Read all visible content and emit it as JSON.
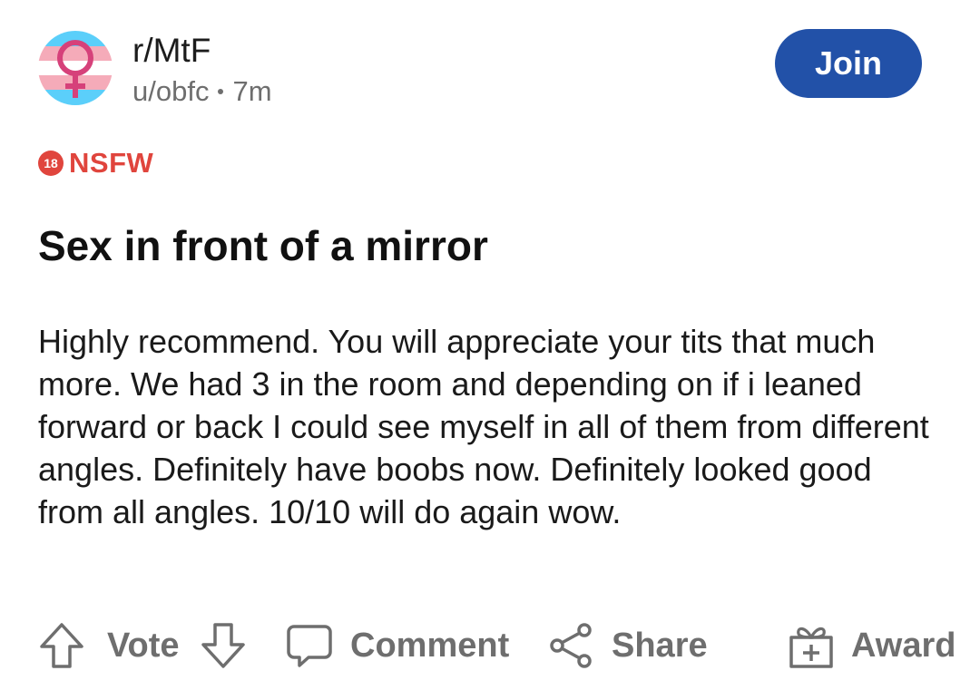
{
  "post": {
    "community": "r/MtF",
    "author": "u/obfc",
    "age": "7m",
    "join_label": "Join",
    "nsfw_badge": "18",
    "nsfw_label": "NSFW",
    "title": "Sex in front of a mirror",
    "body": "Highly recommend. You will appreciate your tits that much more. We had 3 in the room and depending on if i leaned forward or back I could see myself in all of them from different angles. Definitely have boobs now. Definitely looked good from all angles. 10/10 will do again wow."
  },
  "actions": {
    "vote_label": "Vote",
    "comment_label": "Comment",
    "share_label": "Share",
    "award_label": "Award"
  },
  "icons": {
    "avatar": "trans-flag-venus-icon",
    "upvote": "arrow-up-icon",
    "downvote": "arrow-down-icon",
    "comment": "speech-bubble-icon",
    "share": "share-nodes-icon",
    "award": "gift-box-icon"
  },
  "colors": {
    "join_button": "#2251a8",
    "nsfw": "#e0453d",
    "trans_blue": "#5bcffa",
    "trans_pink": "#f5abb9",
    "muted_text": "#6e6e6e"
  }
}
